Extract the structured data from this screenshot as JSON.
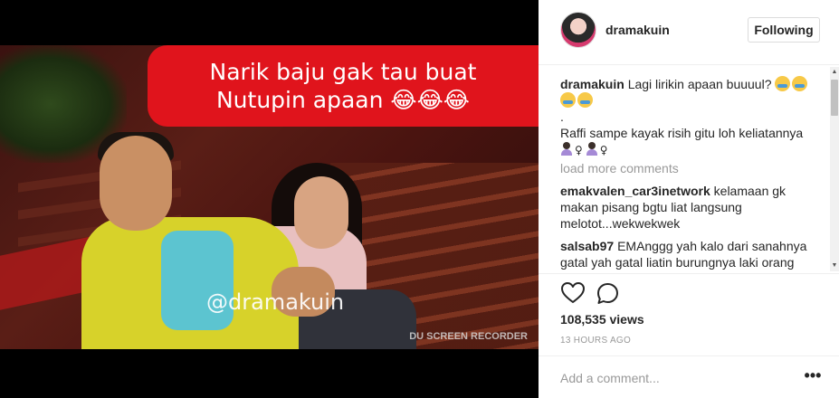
{
  "video": {
    "caption_line1": "Narik baju gak tau buat",
    "caption_line2": "Nutupin apaan 😂😂😂",
    "watermark": "@dramakuin",
    "recorder_label": "DU SCREEN RECORDER"
  },
  "header": {
    "username": "dramakuin",
    "follow_label": "Following"
  },
  "caption": {
    "username": "dramakuin",
    "text": "Lagi lirikin apaan buuuul?",
    "dot": ".",
    "line2": "Raffi sampe kayak risih gitu loh keliatannya"
  },
  "load_more": "load more comments",
  "comments": [
    {
      "username": "emakvalen_car3inetwork",
      "text": "kelamaan gk makan pisang bgtu liat langsung melotot...wekwekwek"
    },
    {
      "username": "salsab97",
      "text": "EMAnggg yah kalo dari sanahnya gatal yah gatal liatin burungnya laki orang"
    }
  ],
  "stats": {
    "views": "108,535 views",
    "time_ago": "13 HOURS AGO"
  },
  "comment_box": {
    "placeholder": "Add a comment...",
    "more_label": "•••"
  },
  "icons": {
    "like": "heart-icon",
    "comment": "speech-bubble-icon",
    "avatar": "profile-avatar"
  },
  "colors": {
    "banner": "#e0141c",
    "jacket": "#d7d22a",
    "text": "#262626",
    "muted": "#999999"
  }
}
